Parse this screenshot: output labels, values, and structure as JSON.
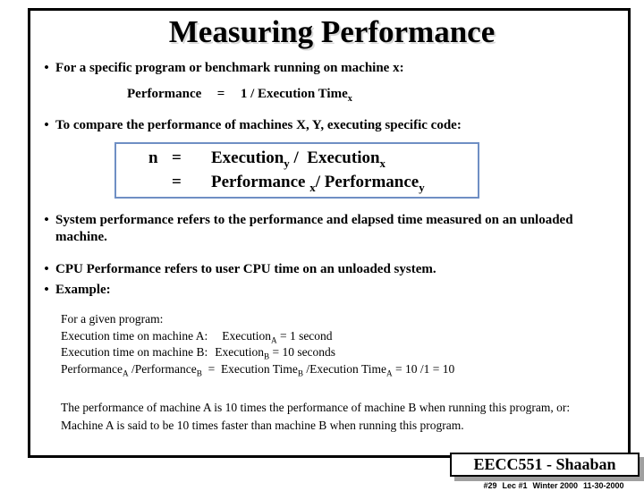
{
  "slide": {
    "title": "Measuring Performance",
    "bullets": [
      {
        "marker": "•",
        "text": "For a specific program or benchmark running on machine x:"
      },
      {
        "marker": "•",
        "text": "To compare the performance of machines X, Y, executing specific code:"
      },
      {
        "marker": "•",
        "text": "System performance refers to the performance and elapsed time measured on an unloaded machine."
      },
      {
        "marker": "•",
        "text": "CPU Performance refers to user CPU time on an unloaded system."
      },
      {
        "marker": "•",
        "text": "Example:"
      }
    ],
    "performance_equation": {
      "lhs": "Performance",
      "operator": "=",
      "rhs": "1 / Execution Time",
      "rhs_subscript": "x"
    },
    "speedup_box": {
      "border_color": "#6f8fc4",
      "line1": {
        "symbol": "n",
        "operator": "=",
        "numerator": "Execution",
        "numerator_subscript": "y",
        "divider": "/",
        "denominator": "Execution",
        "denominator_subscript": "x"
      },
      "line2": {
        "symbol": "",
        "operator": "=",
        "numerator": "Performance",
        "numerator_subscript": "x",
        "divider": "/",
        "denominator": "Performance",
        "denominator_subscript": "y"
      }
    },
    "example": {
      "intro": "For a given program:",
      "line_a_label": "Execution time on machine A:",
      "line_a_term": "Execution",
      "line_a_sub": "A",
      "line_a_value": "=  1  second",
      "line_b_label": "Execution time on machine B:",
      "line_b_term": "Execution",
      "line_b_sub": "B",
      "line_b_value": "=  10  seconds",
      "ratio_left_1": "Performance",
      "ratio_left_1_sub": "A",
      "ratio_left_2": "/Performance",
      "ratio_left_2_sub": "B",
      "ratio_eq": "=",
      "ratio_right_1": "Execution Time",
      "ratio_right_1_sub": "B",
      "ratio_right_2": "/Execution Time",
      "ratio_right_2_sub": "A",
      "ratio_result": "= 10 /1 = 10"
    },
    "conclusion": "The performance of machine A  is 10 times the performance of  machine B when running this program, or:  Machine A  is said to be 10 times faster than machine B when running this program."
  },
  "footer": {
    "course_badge": "EECC551 - Shaaban",
    "slide_number": "#29",
    "lecture": "Lec #1",
    "term": "Winter 2000",
    "date": "11-30-2000"
  }
}
